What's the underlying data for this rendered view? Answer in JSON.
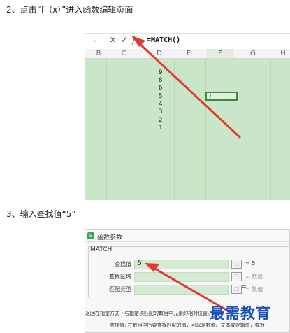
{
  "steps": {
    "step1": "2、点击“f（x）”进入函数编辑页面",
    "step2": "3、输入查找值“5”"
  },
  "spreadsheet": {
    "formula_bar": {
      "cancel_icon": "×",
      "confirm_icon": "✓",
      "fx_label": "fx",
      "formula": "=MATCH()"
    },
    "columns": [
      "B",
      "C",
      "D",
      "E",
      "F",
      "G",
      "H"
    ],
    "selected_column": "F",
    "cell_values": [
      "9",
      "8",
      "6",
      "5",
      "4",
      "3",
      "2",
      "1"
    ],
    "active_cell_text": ")"
  },
  "dialog": {
    "title": "函数参数",
    "function_name": "MATCH",
    "rows": [
      {
        "label": "查找值",
        "value": "5",
        "result": "= 5"
      },
      {
        "label": "查找区域",
        "value": "",
        "result": "= 数值"
      },
      {
        "label": "匹配类型",
        "value": "",
        "result": "= 数值"
      }
    ],
    "result_eq": "=",
    "description": "返回在指定方式下与指定项匹配的数组中元素的相对位置。",
    "param_help": "查找值:   在数组中所要查找匹配的值，可以是数值、文本或逻辑值，或对"
  },
  "watermark": "最需教育",
  "colors": {
    "grid_green": "#c9e6c8",
    "accent_green": "#3b8a3f",
    "arrow_red": "#e53935",
    "watermark_blue": "#1a4fb8"
  }
}
